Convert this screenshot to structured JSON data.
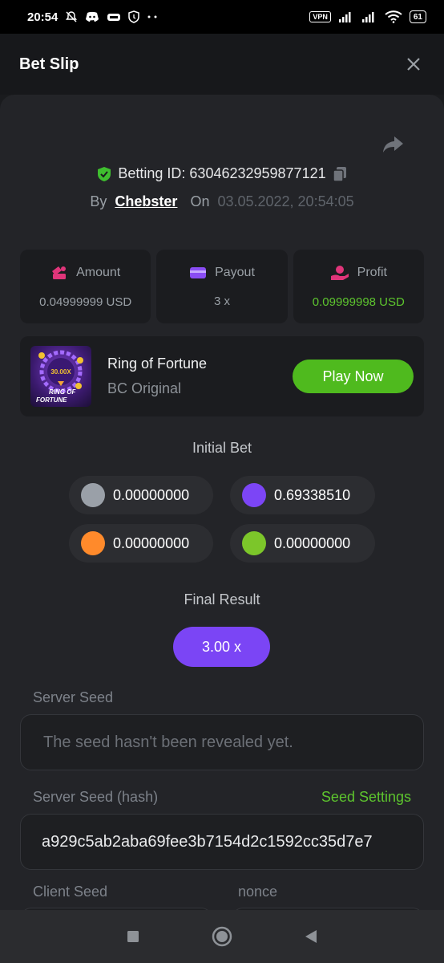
{
  "status_bar": {
    "time": "20:54",
    "vpn": "VPN",
    "battery": "61",
    "icons": [
      "mute-icon",
      "discord-icon",
      "app-icon",
      "shield-icon",
      "more-icon",
      "signal-icon",
      "signal-icon",
      "wifi-icon"
    ]
  },
  "header": {
    "title": "Bet Slip",
    "close_icon": "close-icon"
  },
  "bet": {
    "id_label": "Betting ID: 63046232959877121",
    "by_label": "By",
    "user": "Chebster",
    "on_label": "On",
    "date": "03.05.2022, 20:54:05"
  },
  "stats": [
    {
      "label": "Amount",
      "value": "0.04999999 USD",
      "icon": "coins-icon",
      "color": "#e0357a"
    },
    {
      "label": "Payout",
      "value": "3 x",
      "icon": "wallet-icon",
      "color": "#8a4df4"
    },
    {
      "label": "Profit",
      "value": "0.09999998 USD",
      "icon": "profit-hand-icon",
      "color": "#e0357a"
    }
  ],
  "game": {
    "name": "Ring of Fortune",
    "provider": "BC Original",
    "play_label": "Play Now",
    "thumb_text_top": "30.00X",
    "thumb_text_bottom": "RING OF\nFORTUNE"
  },
  "initial_bet": {
    "title": "Initial Bet",
    "chips": [
      {
        "color": "#9aa0a8",
        "value": "0.00000000"
      },
      {
        "color": "#7c45f6",
        "value": "0.69338510"
      },
      {
        "color": "#ff8a2b",
        "value": "0.00000000"
      },
      {
        "color": "#7cc62a",
        "value": "0.00000000"
      }
    ]
  },
  "final_result": {
    "title": "Final Result",
    "value": "3.00 x"
  },
  "server_seed": {
    "label": "Server Seed",
    "placeholder": "The seed hasn't been revealed yet."
  },
  "server_seed_hash": {
    "label": "Server Seed (hash)",
    "settings_link": "Seed Settings",
    "value": "a929c5ab2aba69fee3b7154d2c1592cc35d7e7"
  },
  "client_seed": {
    "label": "Client Seed"
  },
  "nonce": {
    "label": "nonce"
  },
  "colors": {
    "accent_green": "#4fba1e",
    "accent_purple": "#7b45f5",
    "background": "#232428"
  }
}
